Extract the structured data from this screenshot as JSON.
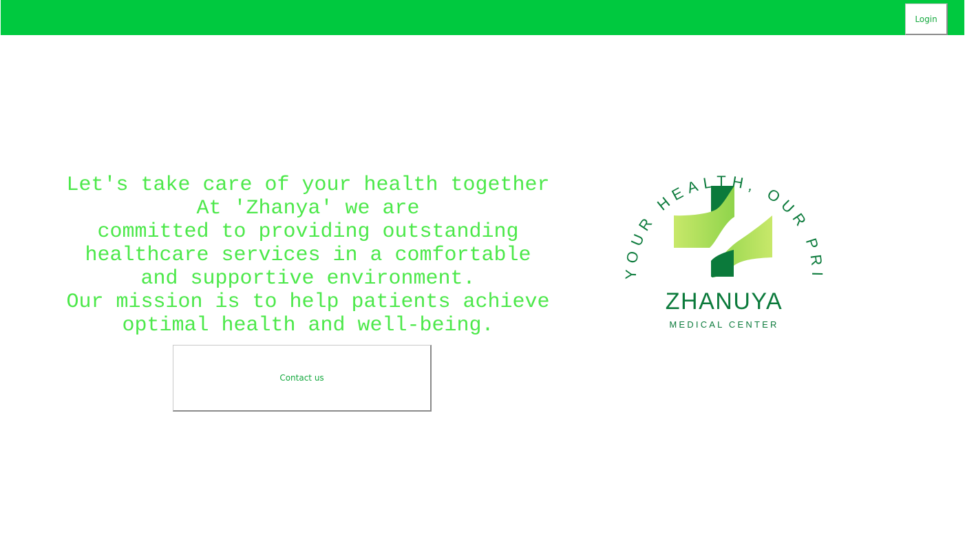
{
  "header": {
    "login_label": "Login",
    "background_color": "#00c93f"
  },
  "hero": {
    "lines": [
      "Let's take care of your health together",
      "At 'Zhanya' we are",
      "committed to providing outstanding",
      "healthcare services in a comfortable",
      "and supportive environment.",
      "Our mission is to help patients achieve",
      "optimal health and well-being."
    ],
    "text_color": "#4ce84a",
    "contact_label": "Contact us"
  },
  "logo": {
    "tagline": "YOUR HEALTH, OUR PRIORITY",
    "name": "ZHANUYA",
    "subtitle": "MEDICAL CENTER",
    "dark_green": "#0b7a3b",
    "light_green": "#c8e86a",
    "icon": "medical-cross-icon"
  }
}
